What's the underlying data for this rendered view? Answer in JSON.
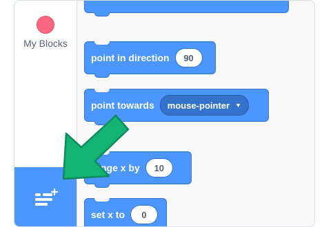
{
  "categories": {
    "my_blocks": {
      "label": "My Blocks",
      "color": "#ff6680"
    }
  },
  "extension_button": {
    "icon": "add-extension-icon",
    "color": "#4c97ff"
  },
  "blocks": {
    "point_in_direction": {
      "label": "point in direction",
      "value": "90"
    },
    "point_towards": {
      "label": "point towards",
      "dropdown": "mouse-pointer"
    },
    "change_x": {
      "label": "change x by",
      "label_visible": "nge x by",
      "value": "10"
    },
    "set_x": {
      "label": "set x to",
      "value": "0"
    }
  },
  "annotation": {
    "icon": "pointer-arrow-icon",
    "color": "#13b374"
  },
  "colors": {
    "motion": "#4c97ff",
    "motion_border": "#3373cc"
  }
}
